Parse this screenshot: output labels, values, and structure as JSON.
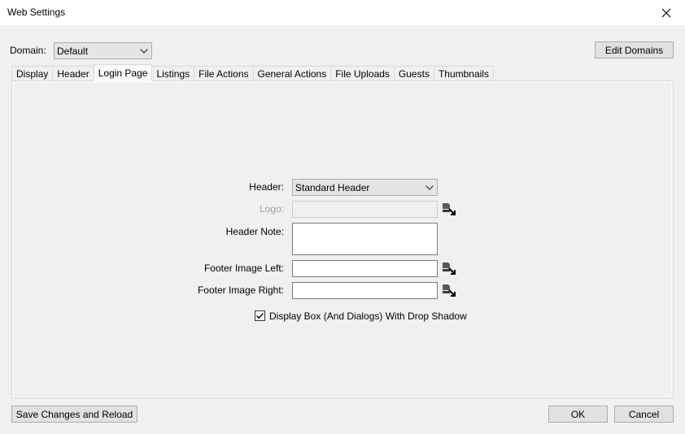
{
  "window": {
    "title": "Web Settings"
  },
  "domain": {
    "label": "Domain:",
    "selected": "Default"
  },
  "buttons": {
    "edit_domains": "Edit Domains",
    "save_reload": "Save Changes and Reload",
    "ok": "OK",
    "cancel": "Cancel"
  },
  "tabs": [
    {
      "label": "Display"
    },
    {
      "label": "Header"
    },
    {
      "label": "Login Page",
      "active": true
    },
    {
      "label": "Listings"
    },
    {
      "label": "File Actions"
    },
    {
      "label": "General Actions"
    },
    {
      "label": "File Uploads"
    },
    {
      "label": "Guests"
    },
    {
      "label": "Thumbnails"
    }
  ],
  "login_page": {
    "header_label": "Header:",
    "header_selected": "Standard Header",
    "logo_label": "Logo:",
    "logo_value": "",
    "header_note_label": "Header Note:",
    "header_note_value": "",
    "footer_left_label": "Footer Image Left:",
    "footer_left_value": "",
    "footer_right_label": "Footer Image Right:",
    "footer_right_value": "",
    "drop_shadow_label": "Display Box (And Dialogs) With Drop Shadow",
    "drop_shadow_checked": true
  },
  "icons": {
    "close": "close-icon",
    "chevron": "chevron-down-icon",
    "browse": "browse-image-icon",
    "check": "checkmark-icon"
  }
}
